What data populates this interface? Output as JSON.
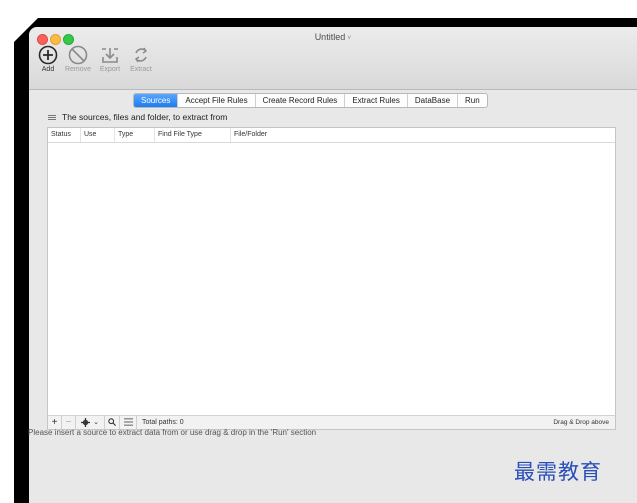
{
  "window": {
    "title": "Untitled",
    "title_caret": "˅"
  },
  "toolbar": {
    "add_label": "Add",
    "remove_label": "Remove",
    "export_label": "Export",
    "extract_label": "Extract"
  },
  "tabs": [
    {
      "label": "Sources",
      "active": true
    },
    {
      "label": "Accept File Rules",
      "active": false
    },
    {
      "label": "Create Record Rules",
      "active": false
    },
    {
      "label": "Extract Rules",
      "active": false
    },
    {
      "label": "DataBase",
      "active": false
    },
    {
      "label": "Run",
      "active": false
    }
  ],
  "sources": {
    "header": "The sources, files and folder, to extract from",
    "columns": [
      "Status",
      "Use",
      "Type",
      "Find File Type",
      "File/Folder"
    ],
    "total_paths_label": "Total paths: 0",
    "drag_drop_label": "Drag & Drop above",
    "add_symbol": "+",
    "remove_symbol": "−",
    "chevron_symbol": "⌄"
  },
  "hint": "Please insert a source to extract data from or use drag & drop in the 'Run' section",
  "watermark": "最需教育",
  "colors": {
    "accent": "#1c7cf1",
    "watermark": "#2a4fb8"
  }
}
